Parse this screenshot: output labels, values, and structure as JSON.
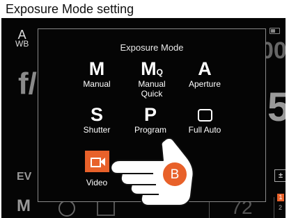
{
  "header": {
    "caption": "Exposure Mode setting"
  },
  "camera": {
    "awb_top": "A",
    "awb_bottom": "WB",
    "fstop": "f/",
    "bg_right_digit": "5",
    "bg_right_top": "00",
    "ev_label": "EV",
    "mode_letter": "M",
    "shots_remaining": "72",
    "badge_top": "1",
    "badge_bottom": "2",
    "exposure_comp_symbol": "+/-"
  },
  "dialog": {
    "title": "Exposure Mode",
    "modes": [
      {
        "symbol": "M",
        "label": "Manual"
      },
      {
        "symbol": "M",
        "symbol_sub": "Q",
        "label": "Manual Quick"
      },
      {
        "symbol": "A",
        "label": "Aperture"
      },
      {
        "symbol": "S",
        "label": "Shutter"
      },
      {
        "symbol": "P",
        "label": "Program"
      },
      {
        "symbol": "",
        "label": "Full Auto"
      },
      {
        "symbol": "",
        "label": "Video",
        "selected": true
      }
    ]
  },
  "callout": {
    "label": "B",
    "color": "#e8612a"
  },
  "colors": {
    "accent": "#e8612a",
    "background": "#050505",
    "text": "#ffffff"
  },
  "icons": {
    "video": "video-camera-icon",
    "full_auto": "rounded-square-icon",
    "hand": "pointing-hand-icon",
    "battery": "battery-icon"
  }
}
